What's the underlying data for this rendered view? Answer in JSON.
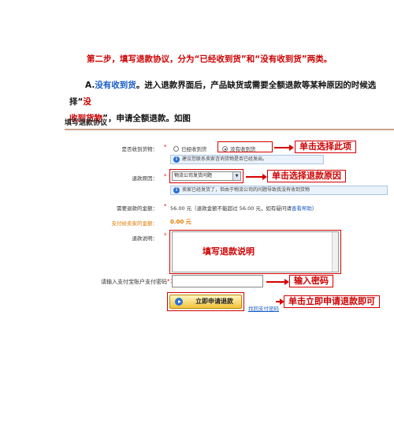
{
  "doc": {
    "step_title": "第二步，填写退款协议，分为“已经收到货”和“没有收到货”两类。",
    "para_prefix": "A.",
    "para_blue": "没有收到货",
    "para_mid": "。进入退款界面后，产品缺货或需要全额退款等某种原因的时候选择“",
    "para_red_1": "没",
    "para_red_2": "收到货物",
    "para_end": "”，申请全额退款。如图"
  },
  "form": {
    "section_title": "填写退款协议",
    "received_label": "是否收到货物：",
    "received_options": [
      "已经收到货",
      "没有收到货"
    ],
    "received_hint": "建议您联系卖家咨询货物是否已经发出。",
    "reason_label": "退款原因：",
    "reason_value": "物流公司发货问题",
    "reason_hint": "卖家已经发货了，但由于物流公司的问题导致我没有收到货物",
    "amount_label": "需要退款的金额：",
    "amount_value": "56.00 元（退款金额不能超过 56.00 元，如有疑问请",
    "amount_link": "查看帮助",
    "amount_close": "）",
    "paid_label": "支付给卖家的金额：",
    "paid_value": "0.00 元",
    "desc_label": "退款说明：",
    "pwd_label": "请输入支付宝账户支付密码",
    "pwd_required": "*：",
    "submit_label": "立即申请退款",
    "forgot_link": "找回支付密码"
  },
  "annotations": {
    "select_option": "单击选择此项",
    "select_reason": "单击选择退款原因",
    "fill_desc": "填写退款说明",
    "enter_pwd": "输入密码",
    "submit": "单击立即申请退款即可"
  }
}
